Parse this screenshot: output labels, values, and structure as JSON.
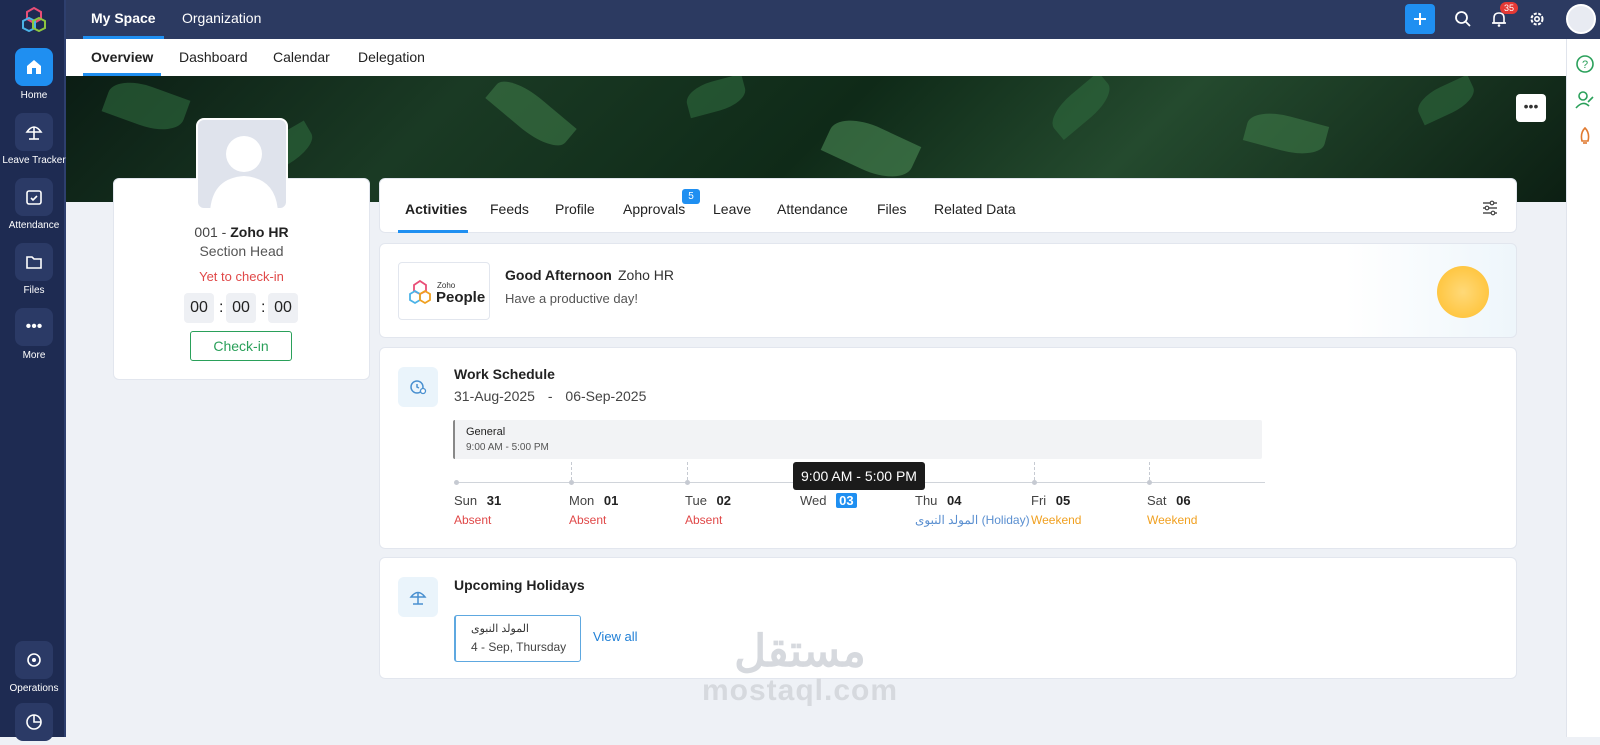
{
  "app": {
    "top_tabs": [
      "My Space",
      "Organization"
    ],
    "notifications_count": "35"
  },
  "sidebar": {
    "items": [
      {
        "label": "Home",
        "icon": "home-icon"
      },
      {
        "label": "Leave Tracker",
        "icon": "umbrella-icon"
      },
      {
        "label": "Attendance",
        "icon": "calendar-check-icon"
      },
      {
        "label": "Files",
        "icon": "folder-icon"
      },
      {
        "label": "More",
        "icon": "more-dots-icon"
      },
      {
        "label": "Operations",
        "icon": "operations-icon"
      }
    ]
  },
  "subtabs": [
    "Overview",
    "Dashboard",
    "Calendar",
    "Delegation"
  ],
  "profile": {
    "id_prefix": "001 - ",
    "name": "Zoho HR",
    "role": "Section Head",
    "status": "Yet to check-in",
    "timer": {
      "h": "00",
      "m": "00",
      "s": "00"
    },
    "checkin_label": "Check-in"
  },
  "tabs": [
    "Activities",
    "Feeds",
    "Profile",
    "Approvals",
    "Leave",
    "Attendance",
    "Files",
    "Related Data"
  ],
  "approvals_badge": "5",
  "greeting": {
    "logo_small": "Zoho",
    "logo_big": "People",
    "title": "Good Afternoon",
    "name": "Zoho HR",
    "subtitle": "Have a productive day!"
  },
  "schedule": {
    "title": "Work Schedule",
    "range_start": "31-Aug-2025",
    "range_sep": "-",
    "range_end": "06-Sep-2025",
    "shift_name": "General",
    "shift_time": "9:00 AM - 5:00 PM",
    "tooltip": "9:00 AM - 5:00 PM",
    "days": [
      {
        "day": "Sun",
        "date": "31",
        "status": "Absent"
      },
      {
        "day": "Mon",
        "date": "01",
        "status": "Absent"
      },
      {
        "day": "Tue",
        "date": "02",
        "status": "Absent"
      },
      {
        "day": "Wed",
        "date": "03",
        "status": ""
      },
      {
        "day": "Thu",
        "date": "04",
        "status": "المولد النبوى (Holiday)"
      },
      {
        "day": "Fri",
        "date": "05",
        "status": "Weekend"
      },
      {
        "day": "Sat",
        "date": "06",
        "status": "Weekend"
      }
    ]
  },
  "holidays": {
    "title": "Upcoming Holidays",
    "item_name": "المولد النبوى",
    "item_date": "4 - Sep, Thursday",
    "view_all": "View all"
  },
  "watermark": {
    "arabic": "مستقل",
    "latin": "mostaql.com"
  }
}
